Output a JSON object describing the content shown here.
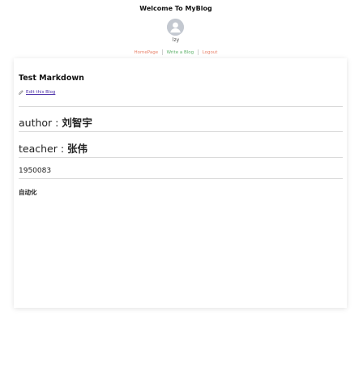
{
  "header": {
    "title": "Welcome To MyBlog",
    "username": "lzy"
  },
  "nav": {
    "items": [
      {
        "label": "HomePage",
        "color": "#e8836b"
      },
      {
        "label": "Write a Blog",
        "color": "#5fb26b"
      },
      {
        "label": "Logout",
        "color": "#e8836b"
      }
    ]
  },
  "post": {
    "title": "Test Markdown",
    "edit_label": "Edit this Blog",
    "author_label": "author : ",
    "author_name": "刘智宇",
    "teacher_label": "teacher : ",
    "teacher_name": "张伟",
    "number": "1950083",
    "tag": "自动化"
  },
  "colors": {
    "avatar_bg": "#c3c8d0",
    "link_purple": "#4b2fa8"
  },
  "icons": [
    "avatar-icon",
    "pencil-icon"
  ]
}
